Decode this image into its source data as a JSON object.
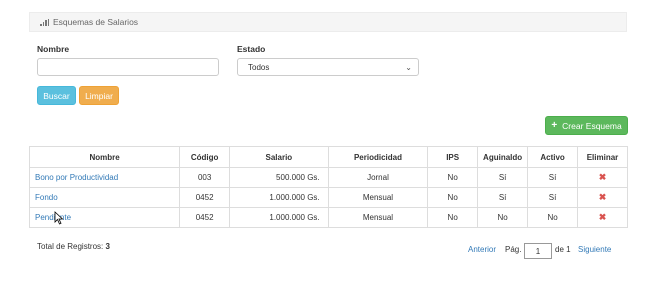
{
  "header": {
    "title": "Esquemas de Salarios",
    "icon": "signal-bars-icon"
  },
  "filters": {
    "nombre_label": "Nombre",
    "nombre_value": "",
    "estado_label": "Estado",
    "estado_value": "Todos"
  },
  "buttons": {
    "buscar": "Buscar",
    "limpiar": "Limpiar",
    "crear": "Crear Esquema"
  },
  "table": {
    "columns": [
      "Nombre",
      "Código",
      "Salario",
      "Periodicidad",
      "IPS",
      "Aguinaldo",
      "Activo",
      "Eliminar"
    ],
    "rows": [
      {
        "nombre": "Bono por Productividad",
        "codigo": "003",
        "salario": "500.000 Gs.",
        "periodicidad": "Jornal",
        "ips": "No",
        "aguinaldo": "Sí",
        "activo": "Sí"
      },
      {
        "nombre": "Fondo",
        "codigo": "0452",
        "salario": "1.000.000 Gs.",
        "periodicidad": "Mensual",
        "ips": "No",
        "aguinaldo": "Sí",
        "activo": "Sí"
      },
      {
        "nombre": "Pendiente",
        "codigo": "0452",
        "salario": "1.000.000 Gs.",
        "periodicidad": "Mensual",
        "ips": "No",
        "aguinaldo": "No",
        "activo": "No"
      }
    ]
  },
  "footer": {
    "total_label": "Total de Registros:",
    "total_value": "3",
    "anterior": "Anterior",
    "pag_label": "Pág.",
    "page": "1",
    "of_label": "de 1",
    "siguiente": "Siguiente"
  },
  "colors": {
    "info": "#5bc0de",
    "warning": "#f0ad4e",
    "success": "#5cb85c",
    "danger": "#d9534f",
    "link": "#337ab7"
  }
}
